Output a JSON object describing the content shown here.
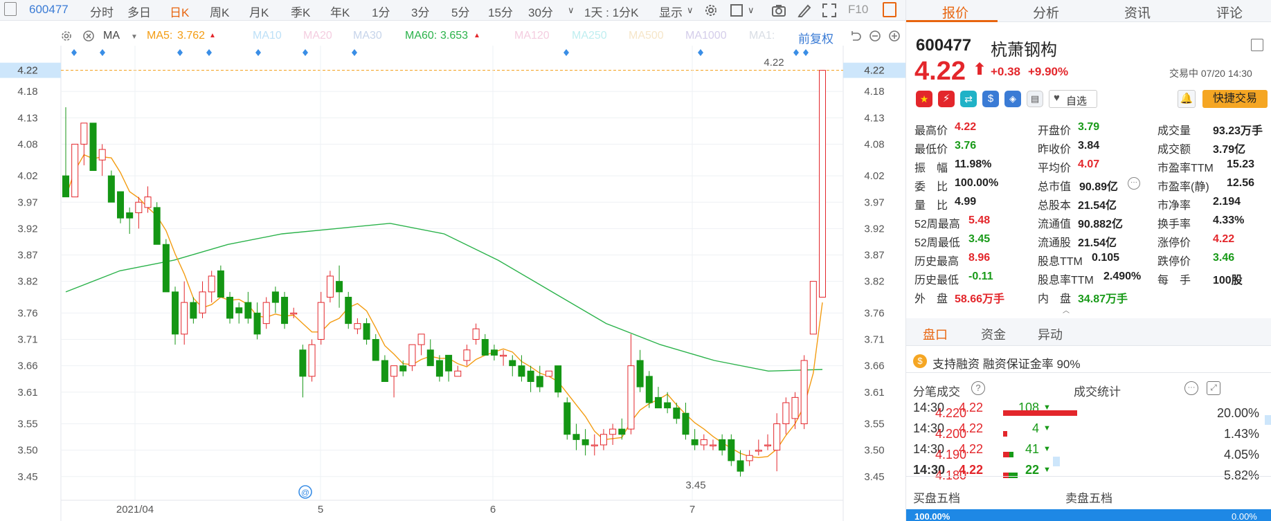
{
  "toolbar": {
    "code": "600477",
    "items": [
      "分时",
      "多日",
      "日K",
      "周K",
      "月K",
      "季K",
      "年K",
      "1分",
      "3分",
      "5分",
      "15分",
      "30分"
    ],
    "active": "日K",
    "interval": "1天 : 1分K",
    "display": "显示",
    "f10": "F10"
  },
  "indicator_bar": {
    "ma": "MA",
    "ma5_label": "MA5:",
    "ma5_value": "3.762",
    "ma10": "MA10",
    "ma20": "MA20",
    "ma30": "MA30",
    "ma60_label": "MA60:",
    "ma60_value": "3.653",
    "ma120": "MA120",
    "ma250": "MA250",
    "ma500": "MA500",
    "ma1000": "MA1000",
    "ma1": "MA1:",
    "adjust": "前复权"
  },
  "chart_data": {
    "type": "candlestick",
    "yticks": [
      "4.22",
      "4.18",
      "4.13",
      "4.08",
      "4.02",
      "3.97",
      "3.92",
      "3.87",
      "3.82",
      "3.76",
      "3.71",
      "3.66",
      "3.61",
      "3.55",
      "3.50",
      "3.45"
    ],
    "xticks": [
      "2021/04",
      "5",
      "6",
      "7"
    ],
    "current_price_label": "4.22",
    "high_annotation": "4.22",
    "low_annotation": "3.45",
    "ma5_last": 3.762,
    "ma60_last": 3.653,
    "colors": {
      "up": "#e3262b",
      "down": "#149614",
      "ma5": "#f39c12",
      "ma60": "#2ab24a"
    },
    "candles": [
      [
        4.02,
        4.15,
        3.98,
        3.98
      ],
      [
        3.98,
        4.08,
        3.98,
        4.08
      ],
      [
        4.08,
        4.12,
        4.04,
        4.12
      ],
      [
        4.12,
        4.12,
        4.03,
        4.03
      ],
      [
        4.05,
        4.08,
        4.02,
        4.07
      ],
      [
        4.02,
        4.03,
        3.97,
        3.97
      ],
      [
        3.99,
        3.99,
        3.93,
        3.94
      ],
      [
        3.95,
        3.96,
        3.91,
        3.94
      ],
      [
        3.95,
        3.98,
        3.92,
        3.97
      ],
      [
        3.96,
        4.0,
        3.95,
        3.98
      ],
      [
        3.96,
        3.97,
        3.89,
        3.89
      ],
      [
        3.89,
        3.9,
        3.8,
        3.8
      ],
      [
        3.8,
        3.81,
        3.7,
        3.72
      ],
      [
        3.72,
        3.82,
        3.7,
        3.78
      ],
      [
        3.78,
        3.79,
        3.74,
        3.75
      ],
      [
        3.76,
        3.82,
        3.75,
        3.8
      ],
      [
        3.8,
        3.84,
        3.78,
        3.83
      ],
      [
        3.84,
        3.85,
        3.79,
        3.79
      ],
      [
        3.79,
        3.8,
        3.74,
        3.75
      ],
      [
        3.77,
        3.78,
        3.74,
        3.76
      ],
      [
        3.78,
        3.8,
        3.74,
        3.75
      ],
      [
        3.76,
        3.78,
        3.71,
        3.72
      ],
      [
        3.74,
        3.79,
        3.73,
        3.78
      ],
      [
        3.8,
        3.81,
        3.76,
        3.78
      ],
      [
        3.79,
        3.8,
        3.73,
        3.74
      ],
      [
        3.76,
        3.77,
        3.75,
        3.76
      ],
      [
        3.69,
        3.7,
        3.6,
        3.64
      ],
      [
        3.64,
        3.71,
        3.63,
        3.7
      ],
      [
        3.71,
        3.8,
        3.7,
        3.78
      ],
      [
        3.79,
        3.84,
        3.78,
        3.83
      ],
      [
        3.82,
        3.85,
        3.77,
        3.8
      ],
      [
        3.79,
        3.8,
        3.73,
        3.74
      ],
      [
        3.73,
        3.75,
        3.72,
        3.74
      ],
      [
        3.74,
        3.75,
        3.7,
        3.71
      ],
      [
        3.71,
        3.72,
        3.67,
        3.67
      ],
      [
        3.67,
        3.68,
        3.63,
        3.63
      ],
      [
        3.64,
        3.66,
        3.6,
        3.66
      ],
      [
        3.66,
        3.67,
        3.64,
        3.65
      ],
      [
        3.66,
        3.7,
        3.65,
        3.7
      ],
      [
        3.7,
        3.72,
        3.68,
        3.72
      ],
      [
        3.69,
        3.71,
        3.66,
        3.66
      ],
      [
        3.67,
        3.68,
        3.63,
        3.64
      ],
      [
        3.68,
        3.68,
        3.63,
        3.65
      ],
      [
        3.64,
        3.66,
        3.64,
        3.65
      ],
      [
        3.67,
        3.7,
        3.66,
        3.69
      ],
      [
        3.71,
        3.74,
        3.7,
        3.73
      ],
      [
        3.71,
        3.72,
        3.68,
        3.68
      ],
      [
        3.69,
        3.7,
        3.67,
        3.68
      ],
      [
        3.68,
        3.69,
        3.66,
        3.68
      ],
      [
        3.67,
        3.68,
        3.64,
        3.66
      ],
      [
        3.66,
        3.68,
        3.63,
        3.64
      ],
      [
        3.65,
        3.66,
        3.61,
        3.63
      ],
      [
        3.64,
        3.66,
        3.61,
        3.62
      ],
      [
        3.64,
        3.65,
        3.64,
        3.65
      ],
      [
        3.66,
        3.66,
        3.6,
        3.61
      ],
      [
        3.59,
        3.6,
        3.52,
        3.53
      ],
      [
        3.53,
        3.55,
        3.5,
        3.52
      ],
      [
        3.52,
        3.54,
        3.49,
        3.51
      ],
      [
        3.51,
        3.53,
        3.49,
        3.51
      ],
      [
        3.51,
        3.54,
        3.5,
        3.53
      ],
      [
        3.53,
        3.55,
        3.51,
        3.54
      ],
      [
        3.54,
        3.56,
        3.52,
        3.53
      ],
      [
        3.54,
        3.72,
        3.53,
        3.66
      ],
      [
        3.67,
        3.69,
        3.61,
        3.62
      ],
      [
        3.64,
        3.65,
        3.58,
        3.59
      ],
      [
        3.6,
        3.62,
        3.58,
        3.58
      ],
      [
        3.59,
        3.61,
        3.57,
        3.58
      ],
      [
        3.58,
        3.59,
        3.55,
        3.56
      ],
      [
        3.57,
        3.59,
        3.52,
        3.53
      ],
      [
        3.52,
        3.54,
        3.5,
        3.51
      ],
      [
        3.51,
        3.53,
        3.5,
        3.52
      ],
      [
        3.51,
        3.52,
        3.5,
        3.51
      ],
      [
        3.52,
        3.53,
        3.49,
        3.5
      ],
      [
        3.52,
        3.53,
        3.47,
        3.48
      ],
      [
        3.48,
        3.5,
        3.45,
        3.46
      ],
      [
        3.48,
        3.5,
        3.47,
        3.49
      ],
      [
        3.5,
        3.52,
        3.49,
        3.5
      ],
      [
        3.51,
        3.53,
        3.5,
        3.51
      ],
      [
        3.5,
        3.57,
        3.46,
        3.55
      ],
      [
        3.55,
        3.6,
        3.53,
        3.59
      ],
      [
        3.56,
        3.61,
        3.54,
        3.6
      ],
      [
        3.55,
        3.68,
        3.54,
        3.67
      ],
      [
        3.72,
        3.8,
        3.72,
        3.82
      ],
      [
        3.79,
        3.88,
        3.79,
        4.22
      ]
    ],
    "ma60": [
      3.8,
      3.84,
      3.86,
      3.89,
      3.91,
      3.92,
      3.93,
      3.91,
      3.86,
      3.8,
      3.74,
      3.7,
      3.67,
      3.65,
      3.653
    ]
  },
  "quote": {
    "tabs": [
      "报价",
      "分析",
      "资讯",
      "评论"
    ],
    "code": "600477",
    "name": "杭萧钢构",
    "price": "4.22",
    "change": "+0.38",
    "pct": "+9.90%",
    "trading_status": "交易中 07/20 14:30",
    "watch_label": "自选",
    "trade_label": "快捷交易",
    "fields": [
      [
        {
          "l": "最高价",
          "v": "4.22",
          "c": "red"
        },
        {
          "l": "开盘价",
          "v": "3.79",
          "c": "green"
        },
        {
          "l": "成交量",
          "v": "93.23万手",
          "c": ""
        }
      ],
      [
        {
          "l": "最低价",
          "v": "3.76",
          "c": "green"
        },
        {
          "l": "昨收价",
          "v": "3.84",
          "c": ""
        },
        {
          "l": "成交额",
          "v": "3.79亿",
          "c": ""
        }
      ],
      [
        {
          "l": "振　幅",
          "v": "11.98%",
          "c": ""
        },
        {
          "l": "平均价",
          "v": "4.07",
          "c": "red"
        },
        {
          "l": "市盈率TTM",
          "v": "15.23",
          "c": ""
        }
      ],
      [
        {
          "l": "委　比",
          "v": "100.00%",
          "c": ""
        },
        {
          "l": "总市值",
          "v": "90.89亿",
          "c": ""
        },
        {
          "l": "市盈率(静)",
          "v": "12.56",
          "c": ""
        }
      ],
      [
        {
          "l": "量　比",
          "v": "4.99",
          "c": ""
        },
        {
          "l": "总股本",
          "v": "21.54亿",
          "c": ""
        },
        {
          "l": "市净率",
          "v": "2.194",
          "c": ""
        }
      ],
      [
        {
          "l": "52周最高",
          "v": "5.48",
          "c": "red"
        },
        {
          "l": "流通值",
          "v": "90.882亿",
          "c": ""
        },
        {
          "l": "换手率",
          "v": "4.33%",
          "c": ""
        }
      ],
      [
        {
          "l": "52周最低",
          "v": "3.45",
          "c": "green"
        },
        {
          "l": "流通股",
          "v": "21.54亿",
          "c": ""
        },
        {
          "l": "涨停价",
          "v": "4.22",
          "c": "red"
        }
      ],
      [
        {
          "l": "历史最高",
          "v": "8.96",
          "c": "red"
        },
        {
          "l": "股息TTM",
          "v": "0.105",
          "c": ""
        },
        {
          "l": "跌停价",
          "v": "3.46",
          "c": "green"
        }
      ],
      [
        {
          "l": "历史最低",
          "v": "-0.11",
          "c": "green"
        },
        {
          "l": "股息率TTM",
          "v": "2.490%",
          "c": ""
        },
        {
          "l": "每　手",
          "v": "100股",
          "c": ""
        }
      ],
      [
        {
          "l": "外　盘",
          "v": "58.66万手",
          "c": "red"
        },
        {
          "l": "内　盘",
          "v": "34.87万手",
          "c": "green"
        },
        {
          "l": "",
          "v": "",
          "c": ""
        }
      ]
    ],
    "sub_tabs": [
      "盘口",
      "资金",
      "异动"
    ],
    "margin_text": "支持融资 融资保证金率 90%",
    "ticks_title": "分笔成交",
    "stats_title": "成交统计",
    "ticks": [
      {
        "t": "14:30",
        "p": "4.22",
        "v": "108"
      },
      {
        "t": "14:30",
        "p": "4.22",
        "v": "4"
      },
      {
        "t": "14:30",
        "p": "4.22",
        "v": "41"
      },
      {
        "t": "14:30",
        "p": "4.22",
        "v": "22"
      }
    ],
    "stats": [
      {
        "p": "4.220",
        "pct": "20.00%",
        "w": 0.92,
        "r": 1.0
      },
      {
        "p": "4.200",
        "pct": "1.43%",
        "w": 0.05,
        "r": 1.0
      },
      {
        "p": "4.190",
        "pct": "4.05%",
        "w": 0.13,
        "r": 0.6
      },
      {
        "p": "4.180",
        "pct": "5.82%",
        "w": 0.18,
        "r": 0.4
      }
    ],
    "buy_title": "买盘五档",
    "sell_title": "卖盘五档",
    "bottom_pct": "100.00%",
    "bottom_pct2": "0.00%"
  }
}
